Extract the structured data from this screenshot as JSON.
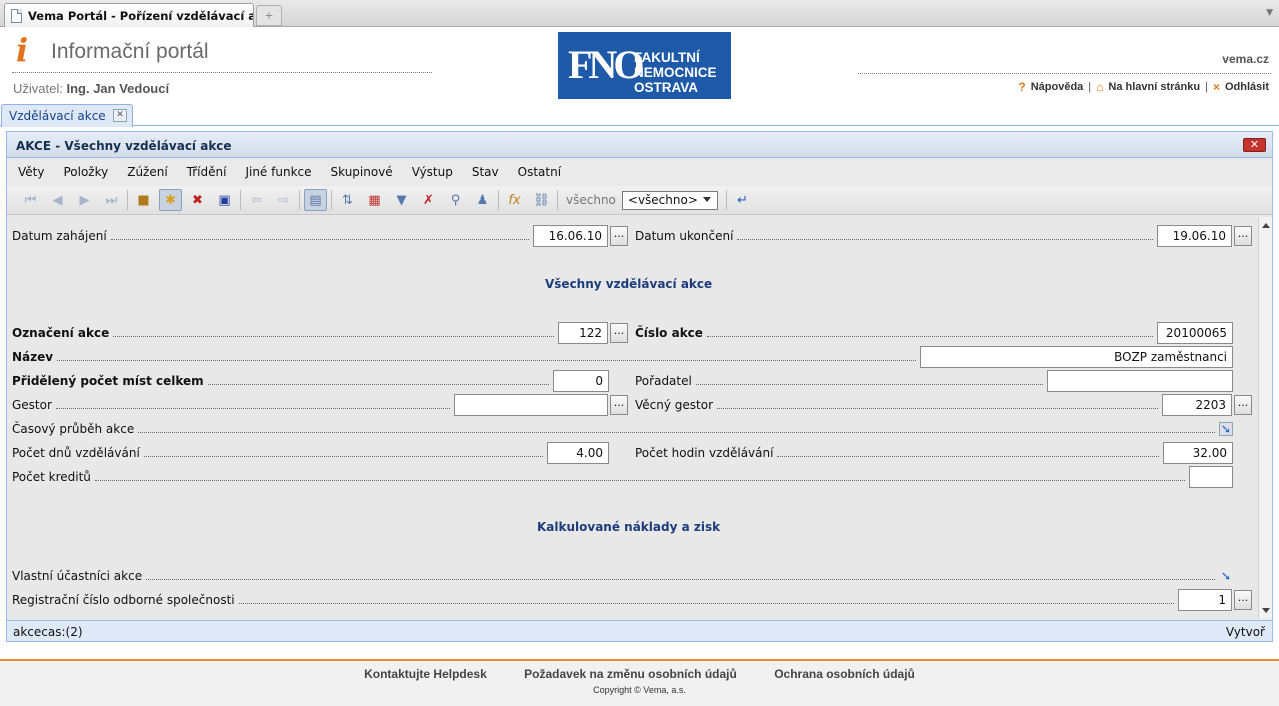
{
  "browser": {
    "tab_title": "Vema Portál - Pořízení vzdělávací akce"
  },
  "header": {
    "logo_letter": "i",
    "portal_title": "Informační portál",
    "user_label": "Uživatel:",
    "user_name": "Ing. Jan Vedoucí",
    "hospital_logo_mono": "FNO",
    "hospital_logo_lines": [
      "FAKULTNÍ",
      "NEMOCNICE",
      "OSTRAVA"
    ],
    "site": "vema.cz",
    "links": {
      "help": "Nápověda",
      "home": "Na hlavní stránku",
      "logout": "Odhlásit"
    }
  },
  "app_tab": {
    "label": "Vzdělávací akce"
  },
  "window": {
    "title": "AKCE - Všechny vzdělávací akce",
    "menu": [
      "Věty",
      "Položky",
      "Zúžení",
      "Třídění",
      "Jiné funkce",
      "Skupinové",
      "Výstup",
      "Stav",
      "Ostatní"
    ],
    "toolbar": {
      "filter_text": "všechno",
      "filter_select": "<všechno>"
    }
  },
  "form": {
    "datum_zahajeni": {
      "label": "Datum zahájení",
      "value": "16.06.10"
    },
    "datum_ukonceni": {
      "label": "Datum ukončení",
      "value": "19.06.10"
    },
    "section1": "Všechny vzdělávací akce",
    "oznaceni_akce": {
      "label": "Označení akce",
      "value": "122"
    },
    "cislo_akce": {
      "label": "Číslo akce",
      "value": "20100065"
    },
    "nazev": {
      "label": "Název",
      "value": "BOZP zaměstnanci"
    },
    "pocet_mist": {
      "label": "Přidělený počet míst celkem",
      "value": "0"
    },
    "poradatel": {
      "label": "Pořadatel",
      "value": ""
    },
    "gestor": {
      "label": "Gestor",
      "value": ""
    },
    "vecny_gestor": {
      "label": "Věcný gestor",
      "value": "2203"
    },
    "casovy_prubeh": {
      "label": "Časový průběh akce"
    },
    "pocet_dnu": {
      "label": "Počet dnů vzdělávání",
      "value": "4.00"
    },
    "pocet_hodin": {
      "label": "Počet hodin vzdělávání",
      "value": "32.00"
    },
    "pocet_kreditu": {
      "label": "Počet kreditů",
      "value": ""
    },
    "section2": "Kalkulované náklady a zisk",
    "vlastni_ucastnici": {
      "label": "Vlastní účastníci akce"
    },
    "registracni_cislo": {
      "label": "Registrační číslo odborné společnosti",
      "value": "1"
    }
  },
  "status": {
    "left": "akcecas:(2)",
    "right": "Vytvoř"
  },
  "footer": {
    "links": [
      "Kontaktujte Helpdesk",
      "Požadavek na změnu osobních údajů",
      "Ochrana osobních údajů"
    ],
    "copyright": "Copyright © Vema, a.s."
  }
}
